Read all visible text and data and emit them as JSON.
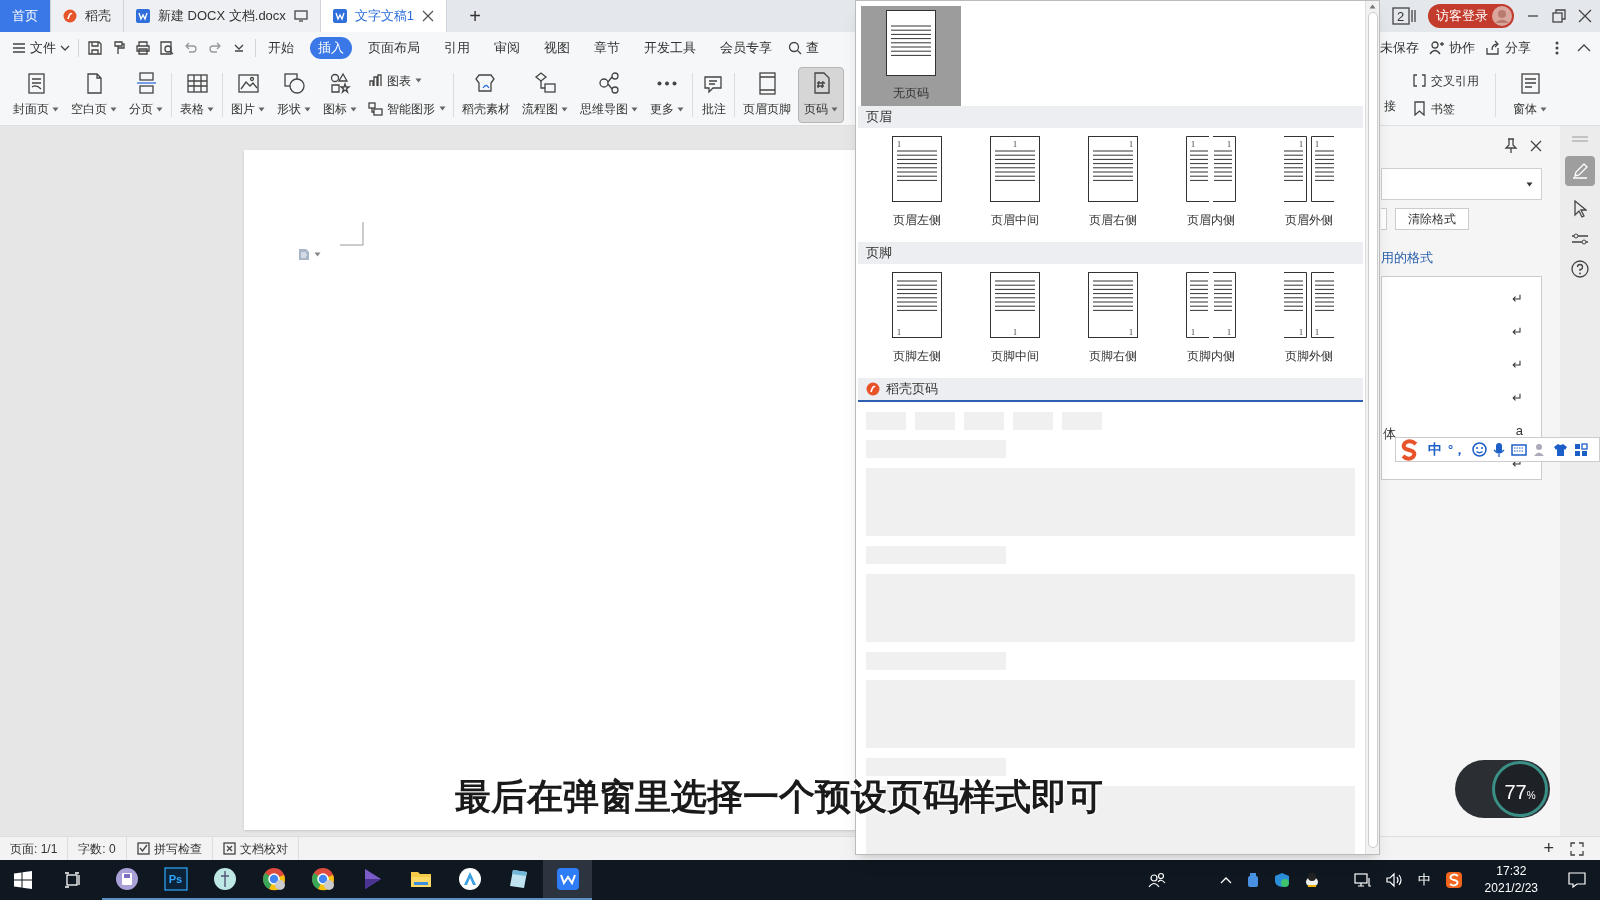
{
  "tabs": [
    {
      "label": "首页",
      "kind": "home",
      "selected": false
    },
    {
      "label": "稻壳",
      "kind": "docer",
      "selected": false
    },
    {
      "label": "新建 DOCX 文档.docx",
      "kind": "doc",
      "selected": false
    },
    {
      "label": "文字文稿1",
      "kind": "doc",
      "selected": true
    }
  ],
  "new_tab_button": "+",
  "window_controls": {
    "window_count": "2",
    "login": "访客登录"
  },
  "menu": {
    "file": "文件",
    "search": "查",
    "tabs": [
      {
        "label": "开始",
        "selected": false
      },
      {
        "label": "插入",
        "selected": true
      },
      {
        "label": "页面布局",
        "selected": false
      },
      {
        "label": "引用",
        "selected": false
      },
      {
        "label": "审阅",
        "selected": false
      },
      {
        "label": "视图",
        "selected": false
      },
      {
        "label": "章节",
        "selected": false
      },
      {
        "label": "开发工具",
        "selected": false
      },
      {
        "label": "会员专享",
        "selected": false
      }
    ],
    "right": [
      "未保存",
      "协作",
      "分享"
    ]
  },
  "ribbon": [
    [
      {
        "kind": "large",
        "label": "封面页",
        "dropdown": true,
        "selected": false
      },
      {
        "kind": "large",
        "label": "空白页",
        "dropdown": true,
        "selected": false
      },
      {
        "kind": "large",
        "label": "分页",
        "dropdown": true,
        "selected": false
      }
    ],
    [
      {
        "kind": "large",
        "label": "表格",
        "dropdown": true,
        "selected": false
      }
    ],
    [
      {
        "kind": "large",
        "label": "图片",
        "dropdown": true,
        "selected": false
      },
      {
        "kind": "large",
        "label": "形状",
        "dropdown": true,
        "selected": false
      },
      {
        "kind": "large",
        "label": "图标",
        "dropdown": true,
        "selected": false
      },
      {
        "kind": "stack",
        "items": [
          {
            "label": "图表",
            "dropdown": true,
            "selected": false
          },
          {
            "label": "智能图形",
            "dropdown": true,
            "selected": false
          }
        ]
      }
    ],
    [
      {
        "kind": "large",
        "label": "稻壳素材",
        "dropdown": false,
        "selected": false
      },
      {
        "kind": "large",
        "label": "流程图",
        "dropdown": true,
        "selected": false
      },
      {
        "kind": "large",
        "label": "思维导图",
        "dropdown": true,
        "selected": false
      },
      {
        "kind": "large",
        "label": "更多",
        "dropdown": true,
        "selected": false
      }
    ],
    [
      {
        "kind": "large",
        "label": "批注",
        "dropdown": false,
        "selected": false
      }
    ],
    [
      {
        "kind": "large",
        "label": "页眉页脚",
        "dropdown": false,
        "selected": false
      },
      {
        "kind": "large",
        "label": "页码",
        "dropdown": true,
        "selected": true
      }
    ]
  ],
  "ribbon_right": [
    {
      "kind": "stack",
      "items": [
        {
          "label": "交叉引用",
          "dropdown": false,
          "selected": false
        },
        {
          "label": "书签",
          "dropdown": false,
          "selected": false
        }
      ]
    },
    {
      "kind": "large",
      "label": "窗体",
      "dropdown": true,
      "selected": false
    }
  ],
  "ribbon_right_cut": "接",
  "page_number_menu": {
    "no_number": {
      "label": "无页码",
      "selected": true
    },
    "sections": [
      {
        "title": "页眉",
        "kind": "header",
        "items": [
          {
            "label": "页眉左侧",
            "kind": "left",
            "numbers": [
              "1"
            ],
            "selected": false
          },
          {
            "label": "页眉中间",
            "kind": "center",
            "numbers": [
              "1"
            ],
            "selected": false
          },
          {
            "label": "页眉右侧",
            "kind": "right",
            "numbers": [
              "1"
            ],
            "selected": false
          },
          {
            "label": "页眉内侧",
            "kind": "inside",
            "numbers": [
              "1",
              "1"
            ],
            "selected": false
          },
          {
            "label": "页眉外侧",
            "kind": "outside",
            "numbers": [
              "1",
              "1"
            ],
            "selected": false
          }
        ]
      },
      {
        "title": "页脚",
        "kind": "footer",
        "items": [
          {
            "label": "页脚左侧",
            "kind": "left",
            "numbers": [
              "1"
            ],
            "selected": false
          },
          {
            "label": "页脚中间",
            "kind": "center",
            "numbers": [
              "1"
            ],
            "selected": false
          },
          {
            "label": "页脚右侧",
            "kind": "right",
            "numbers": [
              "1"
            ],
            "selected": false
          },
          {
            "label": "页脚内侧",
            "kind": "inside",
            "numbers": [
              "1",
              "1"
            ],
            "selected": false
          },
          {
            "label": "页脚外侧",
            "kind": "outside",
            "numbers": [
              "1",
              "1"
            ],
            "selected": false
          }
        ]
      }
    ],
    "docer": {
      "title": "稻壳页码",
      "loading": true
    }
  },
  "styles_panel": {
    "clear_format": "清除格式",
    "recent_heading": "用的格式",
    "font_text": "体",
    "marks": [
      "↵",
      "↵",
      "↵",
      "↵",
      "a",
      "↵"
    ]
  },
  "ime_bar": {
    "mode": "中",
    "punct": "°，"
  },
  "status_bar": [
    {
      "kind": "text",
      "label": "页面: 1/1"
    },
    {
      "kind": "text",
      "label": "字数: 0"
    },
    {
      "kind": "check",
      "label": "拼写检查"
    },
    {
      "kind": "cross",
      "label": "文档校对"
    }
  ],
  "zoom_in": "+",
  "speed_widget": {
    "value": "77",
    "unit": "%"
  },
  "subtitle": "最后在弹窗里选择一个预设页码样式即可",
  "taskbar": {
    "apps": [
      {
        "kind": "disc",
        "selected": false
      },
      {
        "kind": "ps",
        "label": "Ps",
        "selected": false
      },
      {
        "kind": "globe",
        "selected": false
      },
      {
        "kind": "browser",
        "selected": false
      },
      {
        "kind": "browser",
        "selected": false
      },
      {
        "kind": "play",
        "selected": false
      },
      {
        "kind": "folder",
        "selected": false
      },
      {
        "kind": "triangle",
        "selected": false
      },
      {
        "kind": "notepad",
        "selected": false
      },
      {
        "kind": "wps",
        "selected": true
      }
    ],
    "input_mode": "中",
    "time": "17:32",
    "date": "2021/2/23"
  }
}
